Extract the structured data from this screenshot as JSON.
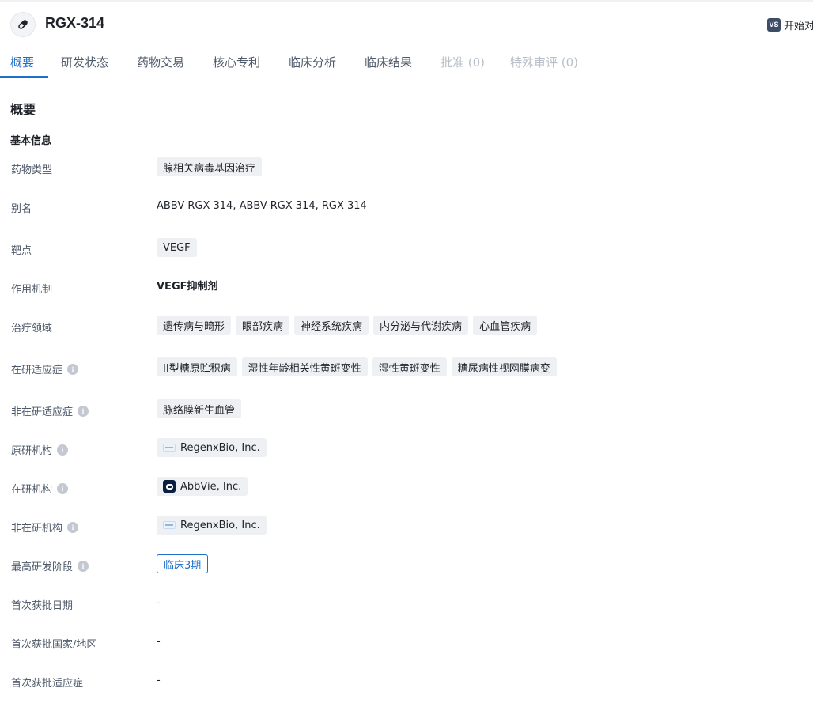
{
  "header": {
    "title": "RGX-314",
    "compare_icon_label": "VS",
    "compare_label": "开始对"
  },
  "tabs": [
    {
      "label": "概要",
      "state": "active"
    },
    {
      "label": "研发状态",
      "state": "normal"
    },
    {
      "label": "药物交易",
      "state": "normal"
    },
    {
      "label": "核心专利",
      "state": "normal"
    },
    {
      "label": "临床分析",
      "state": "normal"
    },
    {
      "label": "临床结果",
      "state": "normal"
    },
    {
      "label": "批准 (0)",
      "state": "disabled"
    },
    {
      "label": "特殊审评 (0)",
      "state": "disabled"
    }
  ],
  "overview": {
    "section_title": "概要",
    "basic_info_title": "基本信息",
    "drug_type": {
      "label": "药物类型",
      "tags": [
        "腺相关病毒基因治疗"
      ]
    },
    "aliases": {
      "label": "别名",
      "value": "ABBV RGX 314, ABBV-RGX-314, RGX 314"
    },
    "target": {
      "label": "靶点",
      "tags": [
        "VEGF"
      ]
    },
    "mechanism": {
      "label": "作用机制",
      "value": "VEGF抑制剂"
    },
    "therapeutic_areas": {
      "label": "治疗领域",
      "tags": [
        "遗传病与畸形",
        "眼部疾病",
        "神经系统疾病",
        "内分泌与代谢疾病",
        "心血管疾病"
      ]
    },
    "active_indications": {
      "label": "在研适应症",
      "tags": [
        "II型糖原贮积病",
        "湿性年龄相关性黄斑变性",
        "湿性黄斑变性",
        "糖尿病性视网膜病变"
      ]
    },
    "inactive_indications": {
      "label": "非在研适应症",
      "tags": [
        "脉络膜新生血管"
      ]
    },
    "originator": {
      "label": "原研机构",
      "org": "RegenxBio, Inc."
    },
    "active_org": {
      "label": "在研机构",
      "org": "AbbVie, Inc."
    },
    "inactive_org": {
      "label": "非在研机构",
      "org": "RegenxBio, Inc."
    },
    "highest_phase": {
      "label": "最高研发阶段",
      "value": "临床3期"
    },
    "first_approval_date": {
      "label": "首次获批日期",
      "value": "-"
    },
    "first_approval_country": {
      "label": "首次获批国家/地区",
      "value": "-"
    },
    "first_approval_indication": {
      "label": "首次获批适应症",
      "value": "-"
    }
  },
  "colors": {
    "accent": "#1d6fc7",
    "tag_bg": "#eef0f3",
    "label_text": "#4e5969"
  }
}
